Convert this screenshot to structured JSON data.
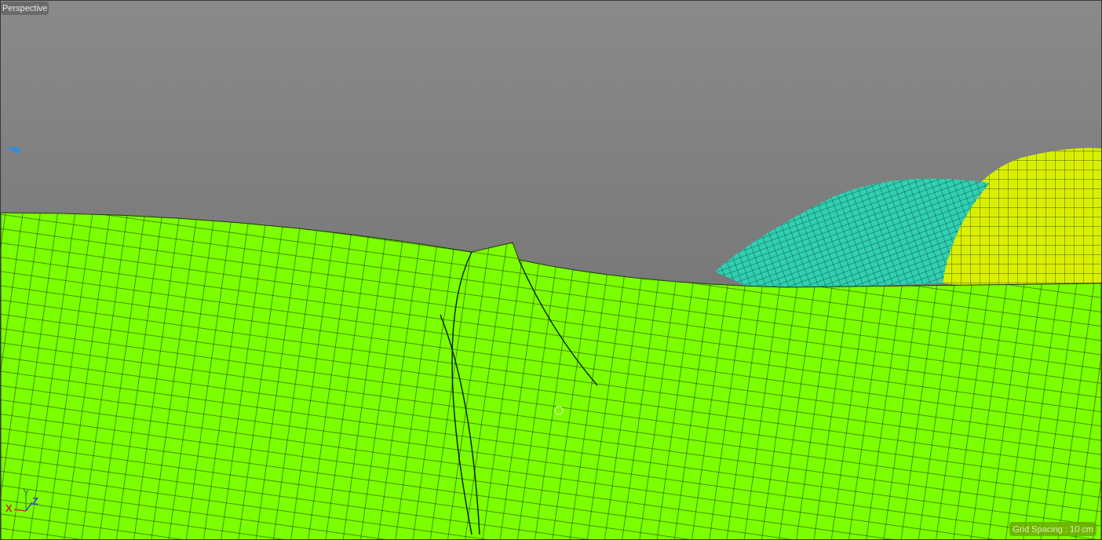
{
  "viewport": {
    "camera_label": "Perspective",
    "grid_spacing": "Grid Spacing : 10 cm",
    "axes": [
      {
        "label": "X",
        "color": "#c0383a"
      },
      {
        "label": "Y",
        "color": "#3aa03a"
      },
      {
        "label": "Z",
        "color": "#3a4ad0"
      }
    ]
  }
}
